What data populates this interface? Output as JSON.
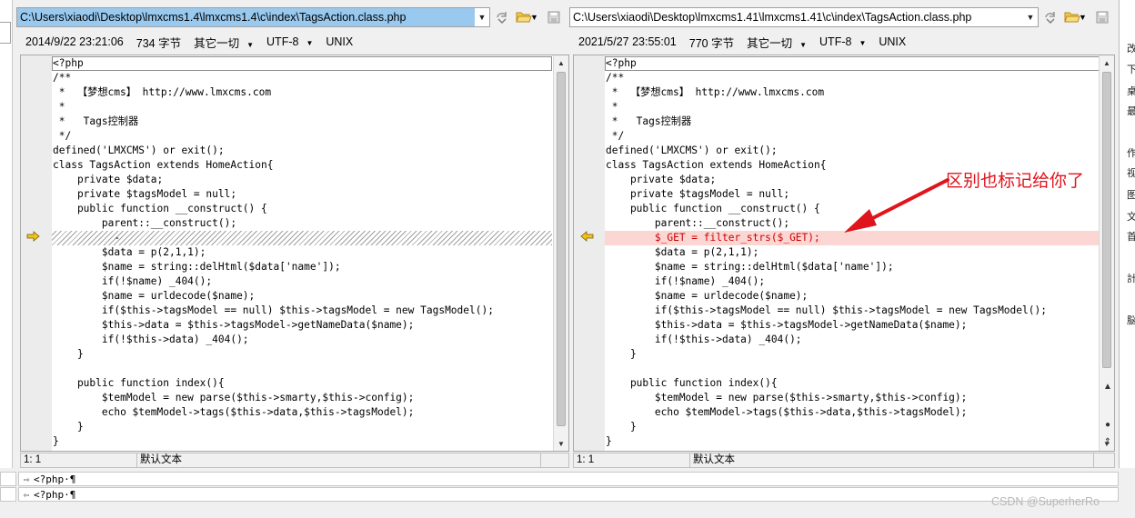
{
  "left": {
    "path": "C:\\Users\\xiaodi\\Desktop\\lmxcms1.4\\lmxcms1.4\\c\\index\\TagsAction.class.php",
    "date": "2014/9/22 23:21:06",
    "size": "734 字节",
    "mode": "其它一切",
    "encoding": "UTF-8",
    "eol": "UNIX",
    "status_pos": "1: 1",
    "status_mode": "默认文本",
    "code": [
      "<?php",
      "/**",
      " *  【梦想cms】 http://www.lmxcms.com",
      " *",
      " *   Tags控制器",
      " */",
      "defined('LMXCMS') or exit();",
      "class TagsAction extends HomeAction{",
      "    private $data;",
      "    private $tagsModel = null;",
      "    public function __construct() {",
      "        parent::__construct();",
      "          -",
      "        $data = p(2,1,1);",
      "        $name = string::delHtml($data['name']);",
      "        if(!$name) _404();",
      "        $name = urldecode($name);",
      "        if($this->tagsModel == null) $this->tagsModel = new TagsModel();",
      "        $this->data = $this->tagsModel->getNameData($name);",
      "        if(!$this->data) _404();",
      "    }",
      "",
      "    public function index(){",
      "        $temModel = new parse($this->smarty,$this->config);",
      "        echo $temModel->tags($this->data,$this->tagsModel);",
      "    }",
      "}",
      "?>"
    ]
  },
  "right": {
    "path": "C:\\Users\\xiaodi\\Desktop\\lmxcms1.41\\lmxcms1.41\\c\\index\\TagsAction.class.php",
    "date": "2021/5/27 23:55:01",
    "size": "770 字节",
    "mode": "其它一切",
    "encoding": "UTF-8",
    "eol": "UNIX",
    "status_pos": "1: 1",
    "status_mode": "默认文本",
    "code": [
      "<?php",
      "/**",
      " *  【梦想cms】 http://www.lmxcms.com",
      " *",
      " *   Tags控制器",
      " */",
      "defined('LMXCMS') or exit();",
      "class TagsAction extends HomeAction{",
      "    private $data;",
      "    private $tagsModel = null;",
      "    public function __construct() {",
      "        parent::__construct();",
      "        $_GET = filter_strs($_GET);",
      "        $data = p(2,1,1);",
      "        $name = string::delHtml($data['name']);",
      "        if(!$name) _404();",
      "        $name = urldecode($name);",
      "        if($this->tagsModel == null) $this->tagsModel = new TagsModel();",
      "        $this->data = $this->tagsModel->getNameData($name);",
      "        if(!$this->data) _404();",
      "    }",
      "",
      "    public function index(){",
      "        $temModel = new parse($this->smarty,$this->config);",
      "        echo $temModel->tags($this->data,$this->tagsModel);",
      "    }",
      "}",
      "?>"
    ]
  },
  "annotation": "区别也标记给你了",
  "bottom_lines": [
    "<?php·¶",
    "<?php·¶"
  ],
  "right_strip": [
    "改",
    "下",
    "桌",
    "最",
    "作",
    "视",
    "图",
    "文",
    "首",
    "計",
    "脳"
  ],
  "watermark": "CSDN @SuperherRo",
  "colors": {
    "diff_bg": "#fbd6d3",
    "diff_text": "#cc0000",
    "annotation": "#e0141c",
    "path_selected": "#99c9ef",
    "gutter_arrow": "#f2c418"
  },
  "icons": [
    "combo-arrow-icon",
    "refresh-icon",
    "folder-open-icon",
    "save-icon",
    "diff-arrow-icon"
  ]
}
